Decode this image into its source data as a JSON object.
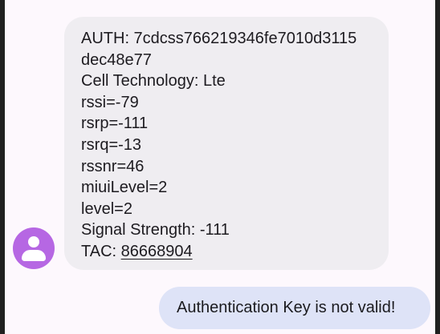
{
  "messages": {
    "incoming": {
      "lines": [
        "AUTH: 7cdcss766219346fe7010d3115",
        "dec48e77",
        "Cell Technology: Lte",
        "rssi=-79",
        "rsrp=-111",
        "rsrq=-13",
        "rssnr=46",
        "miuiLevel=2",
        "level=2",
        "Signal Strength: -111"
      ],
      "tac_label": "TAC: ",
      "tac_value": "86668904"
    },
    "outgoing": {
      "text": "Authentication Key is not valid!"
    }
  },
  "avatar": {
    "icon": "person-icon",
    "color": "#b667e3"
  },
  "colors": {
    "incoming_bubble": "#efedf1",
    "outgoing_bubble": "#dee3f7",
    "background": "#fdf8fd"
  }
}
